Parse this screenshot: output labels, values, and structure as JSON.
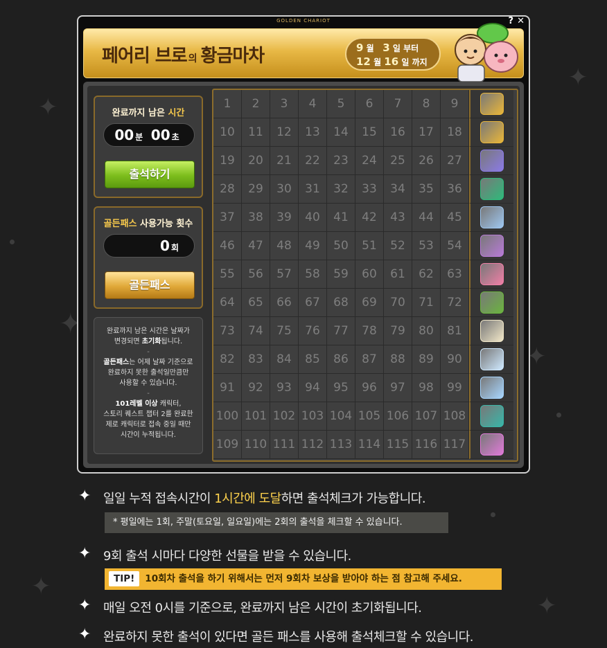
{
  "window": {
    "title": "GOLDEN CHARIOT",
    "help": "?",
    "close": "✕"
  },
  "banner": {
    "title_part1": "페어리 브로",
    "title_particle": "의",
    "title_part2": "황금마차",
    "start_month": "9",
    "start_day": "3",
    "end_month": "12",
    "end_day": "16",
    "unit_month": "월",
    "unit_day": "일",
    "from": "부터",
    "until": "까지"
  },
  "timer": {
    "label_prefix": "완료까지 남은 ",
    "label_bold": "시간",
    "minutes": "00",
    "minutes_unit": "분",
    "seconds": "00",
    "seconds_unit": "초",
    "button": "출석하기"
  },
  "golden_pass": {
    "label_gold": "골든패스",
    "label_rest": " 사용가능 횟수",
    "count": "0",
    "count_unit": "회",
    "button": "골든패스"
  },
  "notice": {
    "line1": "완료까지 남은 시간은 날짜가",
    "line2a": "변경되면 ",
    "line2b": "초기화",
    "line2c": "됩니다.",
    "sep": "-",
    "line3a": "골든패스",
    "line3b": "는 어제 날짜 기준으로",
    "line4": "완료하지 못한 출석일만큼만",
    "line5": "사용할 수 있습니다.",
    "line6a": "101레벨 이상",
    "line6b": " 캐릭터,",
    "line7": "스토리 퀘스트 챕터 2를 완료한",
    "line8": "제로 캐릭터로 접속 중일 때만",
    "line9": "시간이 누적됩니다."
  },
  "days": [
    "1",
    "2",
    "3",
    "4",
    "5",
    "6",
    "7",
    "8",
    "9",
    "10",
    "11",
    "12",
    "13",
    "14",
    "15",
    "16",
    "17",
    "18",
    "19",
    "20",
    "21",
    "22",
    "23",
    "24",
    "25",
    "26",
    "27",
    "28",
    "29",
    "30",
    "31",
    "32",
    "33",
    "34",
    "35",
    "36",
    "37",
    "38",
    "39",
    "40",
    "41",
    "42",
    "43",
    "44",
    "45",
    "46",
    "47",
    "48",
    "49",
    "50",
    "51",
    "52",
    "53",
    "54",
    "55",
    "56",
    "57",
    "58",
    "59",
    "60",
    "61",
    "62",
    "63",
    "64",
    "65",
    "66",
    "67",
    "68",
    "69",
    "70",
    "71",
    "72",
    "73",
    "74",
    "75",
    "76",
    "77",
    "78",
    "79",
    "80",
    "81",
    "82",
    "83",
    "84",
    "85",
    "86",
    "87",
    "88",
    "89",
    "90",
    "91",
    "92",
    "93",
    "94",
    "95",
    "96",
    "97",
    "98",
    "99",
    "100",
    "101",
    "102",
    "103",
    "104",
    "105",
    "106",
    "107",
    "108",
    "109",
    "110",
    "111",
    "112",
    "113",
    "114",
    "115",
    "116",
    "117"
  ],
  "reward_icons": [
    "gold-scroll-icon",
    "gold-scroll-icon",
    "ticket-icon",
    "green-bird-icon",
    "coupon-icon",
    "sparkle-icon",
    "pink-ticket-icon",
    "treasure-chest-icon",
    "egg-icon",
    "ice-cake-icon",
    "cloud-icon",
    "number-seven-icon",
    "gem-box-icon"
  ],
  "reward_colors": [
    "#e9b63a",
    "#e9b63a",
    "#8b7be6",
    "#2fb97b",
    "#9ec6ef",
    "#b77bd6",
    "#ef7fa6",
    "#6bb33f",
    "#f1e7c8",
    "#cfe9ff",
    "#a7d6ff",
    "#39b6a8",
    "#e07ad8"
  ],
  "info": {
    "line1_pre": "일일 누적 접속시간이 ",
    "line1_hl": "1시간에 도달",
    "line1_post": "하면 출석체크가 가능합니다.",
    "note": "* 평일에는 1회, 주말(토요일, 일요일)에는 2회의 출석을 체크할 수 있습니다.",
    "line2": "9회 출석 시마다 다양한 선물을 받을 수 있습니다.",
    "tip_label": "TIP!",
    "tip": "10회차 출석을 하기 위해서는 먼저 9회차 보상을 받아야 하는 점 참고해 주세요.",
    "line3": "매일 오전 0시를 기준으로, 완료까지 남은 시간이 초기화됩니다.",
    "line4": "완료하지 못한 출석이 있다면 골든 패스를 사용해 출석체크할 수 있습니다."
  }
}
